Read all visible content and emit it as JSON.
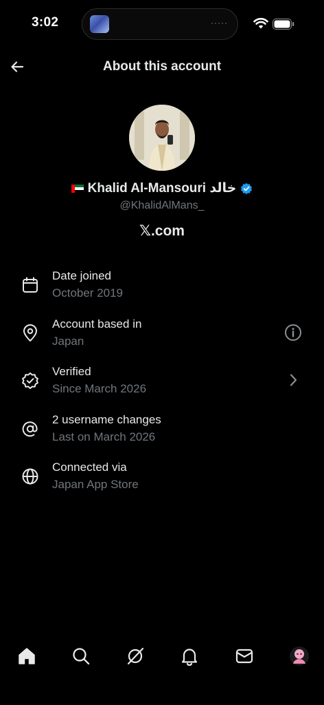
{
  "status_bar": {
    "time": "3:02",
    "island_indicator": "·····"
  },
  "header": {
    "title": "About this account",
    "back_icon": "arrow-left-icon"
  },
  "profile": {
    "name": "Khalid Al-Mansouri خالد",
    "handle": "@KhalidAlMans_",
    "site": "𝕏.com",
    "flag": "UAE",
    "verified": true,
    "verified_color": "#1d9bf0"
  },
  "info": {
    "date_joined": {
      "title": "Date joined",
      "value": "October 2019",
      "icon": "calendar-icon"
    },
    "location": {
      "title": "Account based in",
      "value": "Japan",
      "icon": "location-pin-icon",
      "action_icon": "info-icon"
    },
    "verified": {
      "title": "Verified",
      "value": "Since March 2026",
      "icon": "verified-outline-icon",
      "action_icon": "chevron-right-icon"
    },
    "username_changes": {
      "title": "2 username changes",
      "value": "Last on March 2026",
      "icon": "at-sign-icon"
    },
    "connected_via": {
      "title": "Connected via",
      "value": "Japan App Store",
      "icon": "globe-icon"
    }
  },
  "tab_bar": {
    "items": [
      "home-icon",
      "search-icon",
      "grok-icon",
      "notifications-icon",
      "messages-icon",
      "profile-avatar"
    ],
    "active": "home-icon"
  },
  "colors": {
    "background": "#000000",
    "primary_text": "#e7e9ea",
    "secondary_text": "#71767b",
    "accent": "#1d9bf0"
  }
}
